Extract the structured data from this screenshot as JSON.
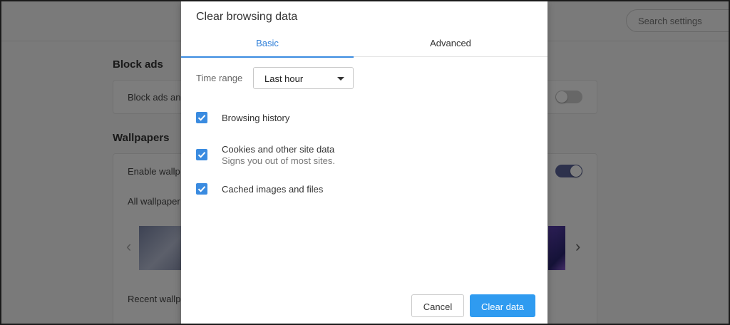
{
  "background": {
    "search": {
      "placeholder": "Search settings"
    },
    "sections": [
      {
        "title": "Block ads",
        "card_text": "Block ads an"
      },
      {
        "title": "Wallpapers",
        "card_text": "Enable wallp",
        "sub_text": "All wallpaper",
        "recent_text": "Recent wallp"
      }
    ],
    "toggles": {
      "block_ads": "off",
      "enable_wallpapers": "on"
    },
    "colors": {
      "toggle_on": "#5a6399",
      "overlay": "rgba(0,0,0,0.5)"
    }
  },
  "dialog": {
    "title": "Clear browsing data",
    "tabs": [
      {
        "label": "Basic",
        "active": true
      },
      {
        "label": "Advanced",
        "active": false
      }
    ],
    "time_range": {
      "label": "Time range",
      "value": "Last hour"
    },
    "options": [
      {
        "label": "Browsing history",
        "checked": true
      },
      {
        "label": "Cookies and other site data",
        "sublabel": "Signs you out of most sites.",
        "checked": true
      },
      {
        "label": "Cached images and files",
        "checked": true
      }
    ],
    "buttons": {
      "cancel": "Cancel",
      "clear": "Clear data"
    },
    "colors": {
      "accent": "#3a8be0",
      "primary_button": "#2f9bf0"
    }
  }
}
